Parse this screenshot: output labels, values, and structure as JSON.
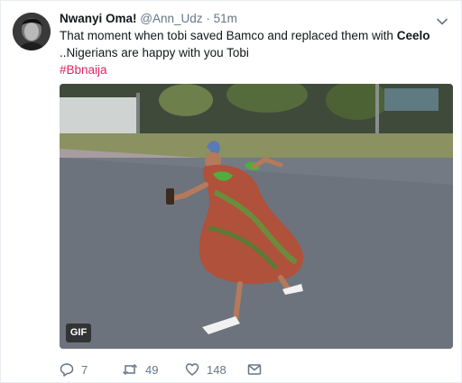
{
  "tweet": {
    "display_name": "Nwanyi Oma!",
    "handle": "@Ann_Udz",
    "separator": "·",
    "time": "51m",
    "text_part1": "That moment when tobi saved Bamco and replaced them with ",
    "text_bold": "Ceelo",
    "text_part2": " ..Nigerians are happy with you Tobi",
    "hashtag": "#Bbnaija",
    "media_badge": "GIF",
    "replies": "7",
    "retweets": "49",
    "likes": "148"
  },
  "colors": {
    "hashtag": "#e0245e",
    "meta": "#657786",
    "text": "#14171a"
  }
}
